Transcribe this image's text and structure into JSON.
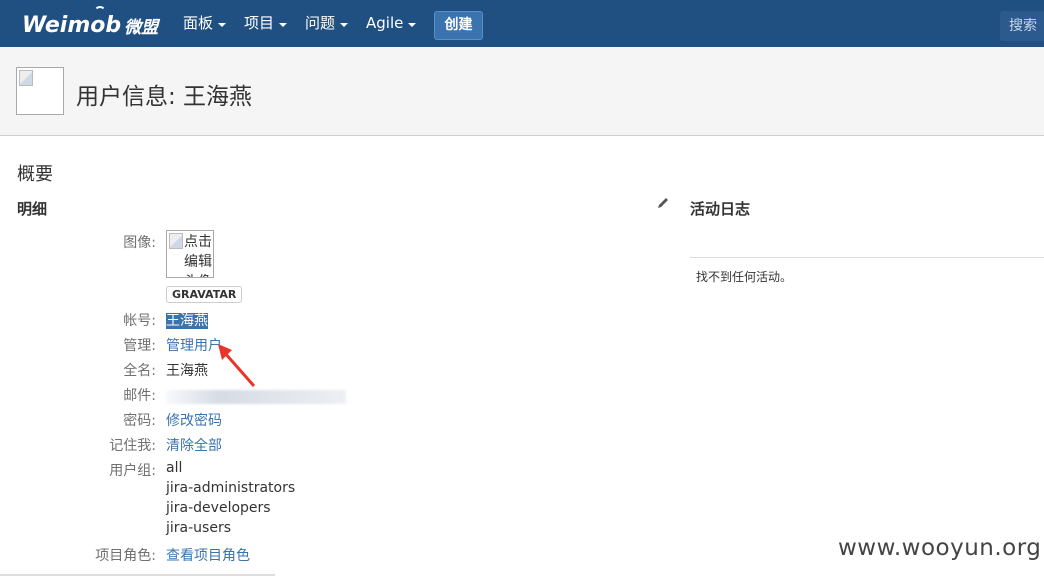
{
  "topbar": {
    "logo_text": "Weimob",
    "logo_cn": "微盟",
    "nav": [
      {
        "label": "面板"
      },
      {
        "label": "项目"
      },
      {
        "label": "问题"
      },
      {
        "label": "Agile"
      }
    ],
    "create_label": "创建",
    "search_placeholder": "搜索"
  },
  "header": {
    "title": "用户信息: 王海燕"
  },
  "summary": {
    "heading": "概要",
    "details_heading": "明细",
    "avatar_label": "图像:",
    "avatar_alt": "点击编辑头像",
    "gravatar_label": "GRAVATAR",
    "account_label": "帐号:",
    "account_value": "王海燕",
    "admin_label": "管理:",
    "admin_link": "管理用户",
    "fullname_label": "全名:",
    "fullname_value": "王海燕",
    "email_label": "邮件:",
    "password_label": "密码:",
    "password_link": "修改密码",
    "remember_label": "记住我:",
    "remember_link": "清除全部",
    "groups_label": "用户组:",
    "groups": [
      "all",
      "jira-administrators",
      "jira-developers",
      "jira-users"
    ],
    "roles_label": "项目角色:",
    "roles_link": "查看项目角色"
  },
  "activity": {
    "heading": "活动日志",
    "empty_text": "找不到任何活动。"
  },
  "watermark": "www.wooyun.org",
  "colors": {
    "topbar": "#205081",
    "link": "#3b73af",
    "arrow": "#e8352a"
  }
}
